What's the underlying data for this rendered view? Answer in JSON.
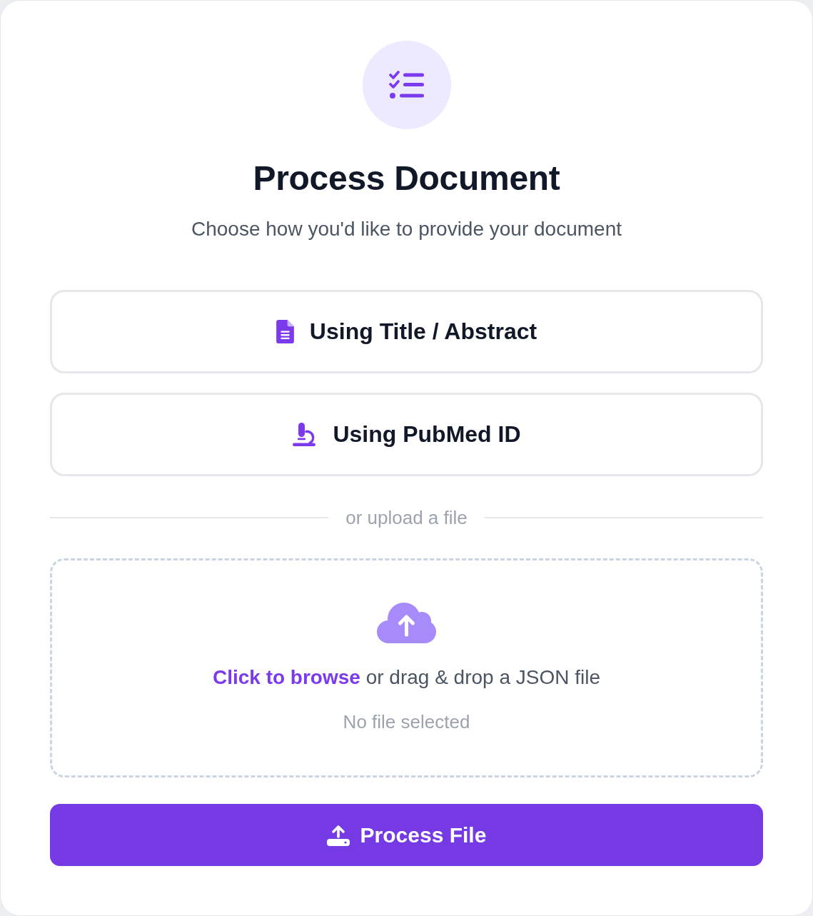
{
  "header": {
    "title": "Process Document",
    "subtitle": "Choose how you'd like to provide your document"
  },
  "options": [
    {
      "kind": "document",
      "label": "Using Title / Abstract"
    },
    {
      "kind": "microscope",
      "label": "Using PubMed ID"
    }
  ],
  "divider": {
    "text": "or upload a file"
  },
  "dropzone": {
    "link": "Click to browse",
    "text": "or drag & drop a JSON file",
    "status": "No file selected"
  },
  "submit": {
    "label": "Process File"
  }
}
